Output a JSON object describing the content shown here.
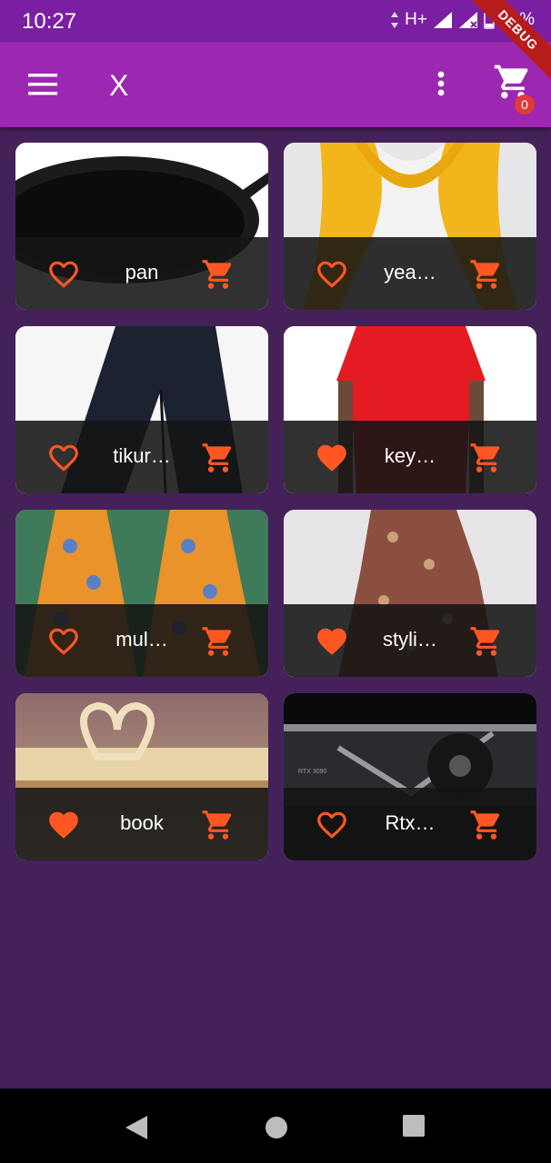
{
  "status_bar": {
    "time": "10:27",
    "network": "H+",
    "battery": "24%"
  },
  "app_bar": {
    "title": "X",
    "cart_count": "0",
    "debug_label": "DEBUG"
  },
  "colors": {
    "primary": "#9c27b0",
    "primary_dark": "#7b1fa2",
    "accent": "#ff5722",
    "background": "#45215a"
  },
  "products": [
    {
      "name": "pan",
      "favorite": false,
      "image": "black-frying-pan"
    },
    {
      "name": "yea…",
      "favorite": false,
      "image": "yellow-knit-scarf"
    },
    {
      "name": "tikur…",
      "favorite": false,
      "image": "black-trousers"
    },
    {
      "name": "key…",
      "favorite": true,
      "image": "red-shirt"
    },
    {
      "name": "mul…",
      "favorite": false,
      "image": "orange-print-dress"
    },
    {
      "name": "styli…",
      "favorite": true,
      "image": "patterned-wrap-dress"
    },
    {
      "name": "book",
      "favorite": true,
      "image": "heart-book-pages"
    },
    {
      "name": "Rtx…",
      "favorite": false,
      "image": "rtx-3090-gpu"
    }
  ],
  "gpu_label": "RTX 3090"
}
